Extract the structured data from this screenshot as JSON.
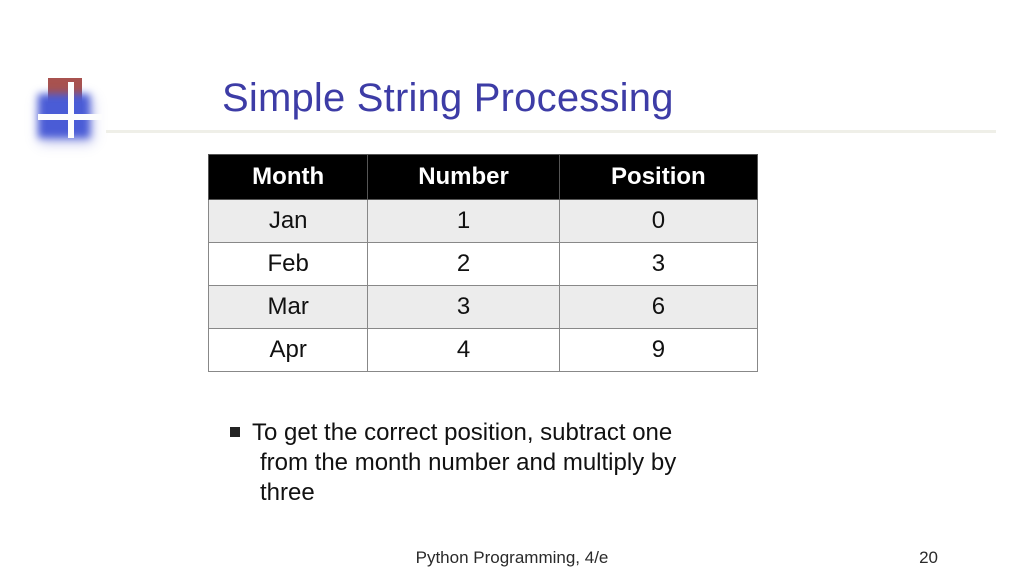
{
  "title": "Simple String Processing",
  "table": {
    "headers": [
      "Month",
      "Number",
      "Position"
    ],
    "rows": [
      {
        "c0": "Jan",
        "c1": "1",
        "c2": "0"
      },
      {
        "c0": "Feb",
        "c1": "2",
        "c2": "3"
      },
      {
        "c0": "Mar",
        "c1": "3",
        "c2": "6"
      },
      {
        "c0": "Apr",
        "c1": "4",
        "c2": "9"
      }
    ]
  },
  "bullet": {
    "line1": "To get the correct position, subtract one",
    "line2": "from the month number and multiply by",
    "line3": "three"
  },
  "footer": "Python Programming, 4/e",
  "page": "20",
  "chart_data": {
    "type": "table",
    "title": "Simple String Processing",
    "columns": [
      "Month",
      "Number",
      "Position"
    ],
    "rows": [
      [
        "Jan",
        1,
        0
      ],
      [
        "Feb",
        2,
        3
      ],
      [
        "Mar",
        3,
        6
      ],
      [
        "Apr",
        4,
        9
      ]
    ]
  }
}
